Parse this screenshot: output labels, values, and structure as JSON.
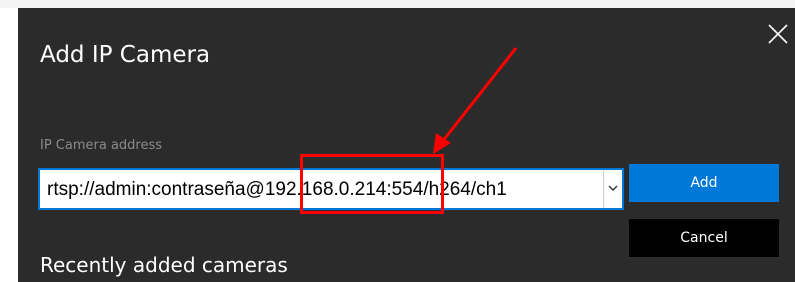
{
  "dialog": {
    "title": "Add IP Camera",
    "close_icon": "close-icon",
    "address_label": "IP Camera address",
    "address_value": "rtsp://admin:contraseña@192.168.0.214:554/h264/ch1",
    "dropdown_icon": "chevron-down-icon",
    "add_label": "Add",
    "cancel_label": "Cancel",
    "recent_title": "Recently added cameras"
  },
  "annotation": {
    "highlight_color": "#ff0000"
  },
  "colors": {
    "dialog_bg": "#2b2b2b",
    "accent": "#0078d7",
    "label_gray": "#8a8a8a"
  }
}
